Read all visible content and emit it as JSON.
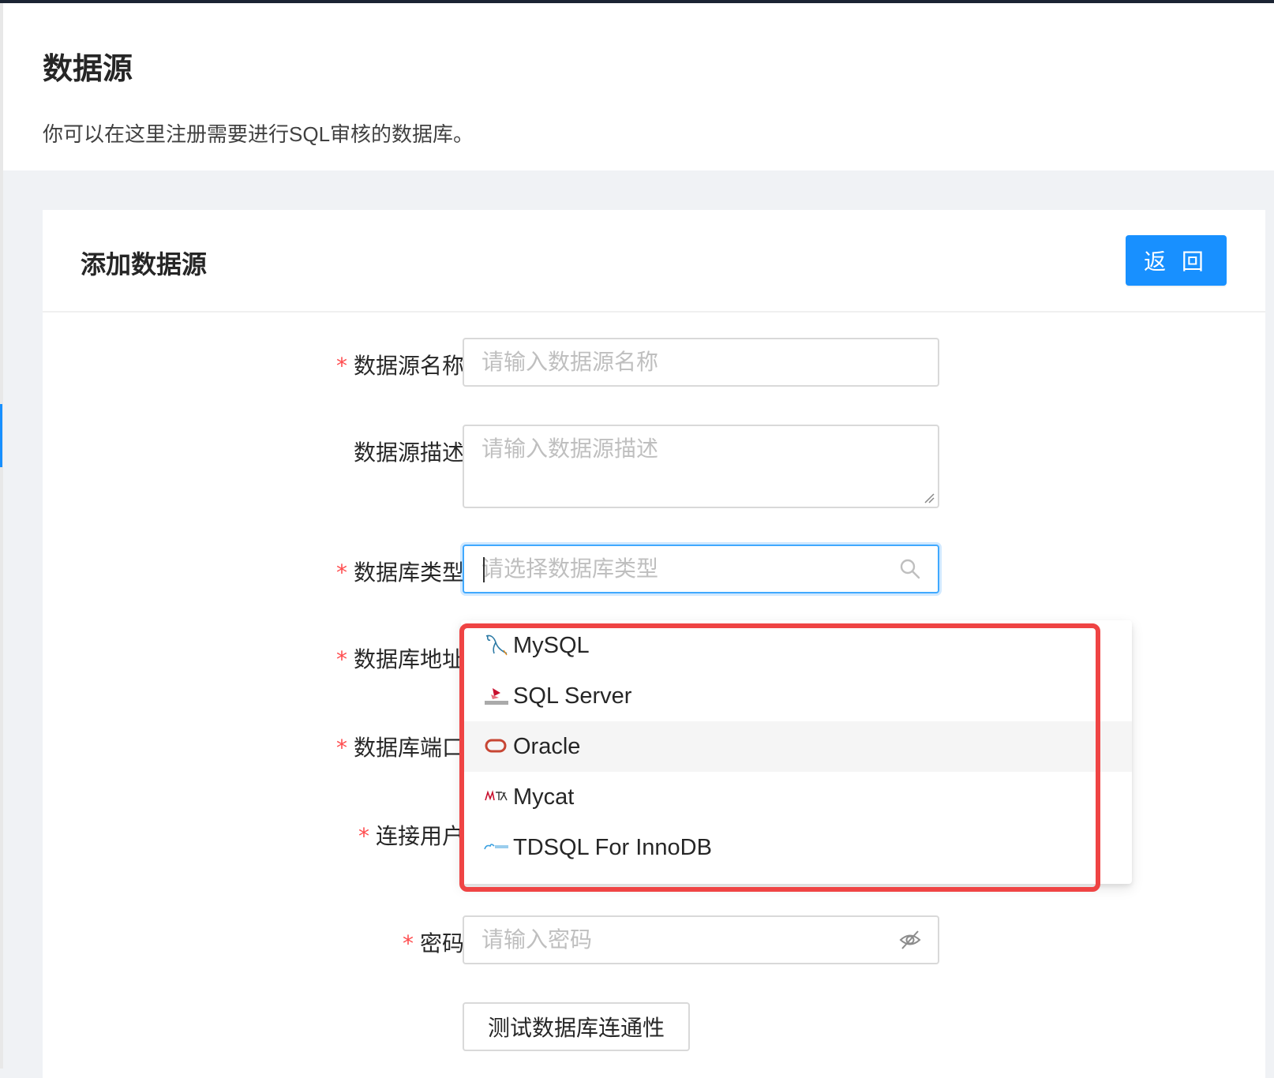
{
  "page": {
    "title": "数据源",
    "description": "你可以在这里注册需要进行SQL审核的数据库。"
  },
  "card": {
    "title": "添加数据源",
    "back_button": "返 回"
  },
  "form": {
    "name": {
      "label": "数据源名称",
      "placeholder": "请输入数据源名称",
      "required": true
    },
    "description": {
      "label": "数据源描述",
      "placeholder": "请输入数据源描述",
      "required": false
    },
    "db_type": {
      "label": "数据库类型",
      "placeholder": "请选择数据库类型",
      "required": true
    },
    "host": {
      "label": "数据库地址",
      "required": true
    },
    "port": {
      "label": "数据库端口",
      "required": true
    },
    "user": {
      "label": "连接用户",
      "required": true
    },
    "password": {
      "label": "密码",
      "placeholder": "请输入密码",
      "required": true
    },
    "colon": "：",
    "required_mark": "*",
    "test_button": "测试数据库连通性"
  },
  "dropdown": {
    "options": [
      {
        "label": "MySQL",
        "icon": "mysql-icon"
      },
      {
        "label": "SQL Server",
        "icon": "sqlserver-icon"
      },
      {
        "label": "Oracle",
        "icon": "oracle-icon",
        "hovered": true
      },
      {
        "label": "Mycat",
        "icon": "mycat-icon"
      },
      {
        "label": "TDSQL For InnoDB",
        "icon": "tdsql-icon"
      }
    ]
  },
  "colors": {
    "primary": "#1890ff",
    "required": "#ff4d4f",
    "highlight": "#ef4444"
  }
}
